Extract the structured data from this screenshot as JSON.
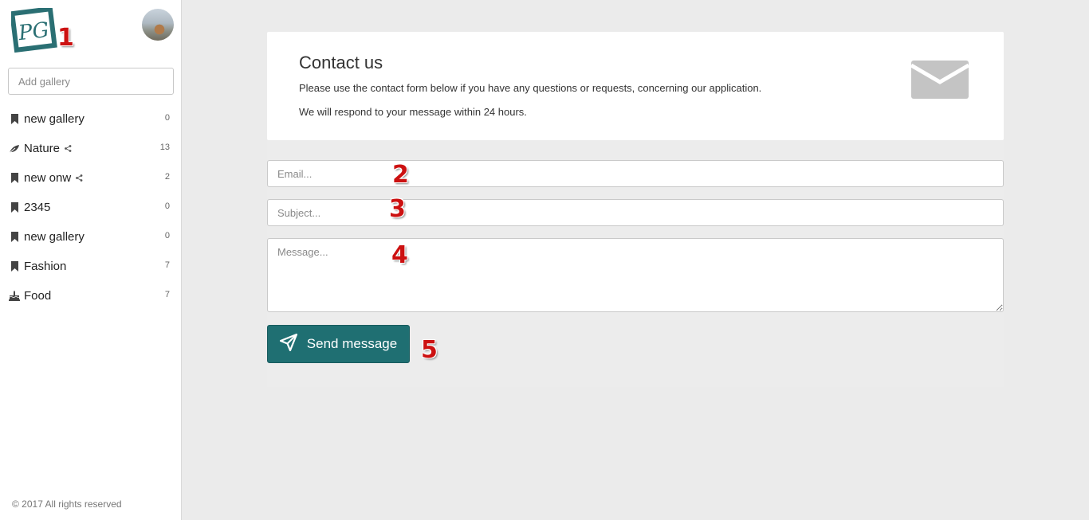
{
  "logo": {
    "text": "PG",
    "color": "#2a6f73"
  },
  "annotations": [
    "1",
    "2",
    "3",
    "4",
    "5"
  ],
  "sidebar": {
    "add_gallery_placeholder": "Add gallery",
    "items": [
      {
        "label": "new gallery",
        "count": "0",
        "icon": "bookmark-icon",
        "shared": false
      },
      {
        "label": "Nature",
        "count": "13",
        "icon": "leaf-icon",
        "shared": true
      },
      {
        "label": "new onw",
        "count": "2",
        "icon": "bookmark-icon",
        "shared": true
      },
      {
        "label": "2345",
        "count": "0",
        "icon": "bookmark-icon",
        "shared": false
      },
      {
        "label": "new gallery",
        "count": "0",
        "icon": "bookmark-icon",
        "shared": false
      },
      {
        "label": "Fashion",
        "count": "7",
        "icon": "bookmark-icon",
        "shared": false
      },
      {
        "label": "Food",
        "count": "7",
        "icon": "cake-icon",
        "shared": false
      }
    ],
    "copyright": "© 2017 All rights reserved"
  },
  "contact": {
    "title": "Contact us",
    "description": "Please use the contact form below if you have any questions or requests, concerning our application.",
    "note": "We will respond to your message within 24 hours.",
    "icon": "envelope-icon"
  },
  "form": {
    "email_placeholder": "Email...",
    "subject_placeholder": "Subject...",
    "message_placeholder": "Message...",
    "send_label": "Send message",
    "accent_color": "#1f6f72"
  }
}
